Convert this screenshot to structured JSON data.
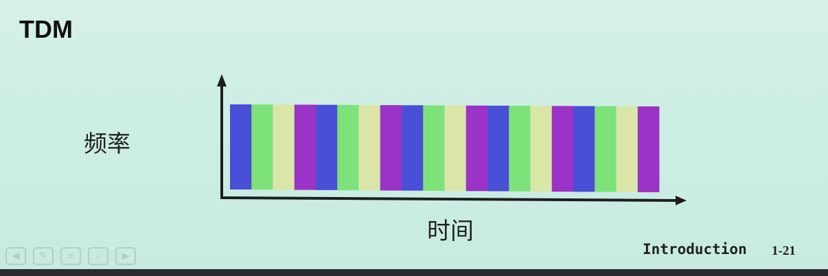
{
  "slide": {
    "title": "TDM",
    "y_axis_label": "频率",
    "x_axis_label": "时间",
    "footer_title": "Introduction",
    "page_number": "1-21"
  },
  "diagram": {
    "slot_colors": {
      "blue": "#4a4fd8",
      "green": "#7ee27a",
      "yellow": "#d9e6a8",
      "purple": "#9a33c6"
    },
    "slots": [
      "blue",
      "green",
      "yellow",
      "purple",
      "blue",
      "green",
      "yellow",
      "purple",
      "blue",
      "green",
      "yellow",
      "purple",
      "blue",
      "green",
      "yellow",
      "purple",
      "blue",
      "green",
      "yellow",
      "purple"
    ],
    "axis_color": "#1e1e1e"
  },
  "controls": {
    "icons": [
      "prev-icon",
      "edit-icon",
      "menu-icon",
      "search-icon",
      "next-icon"
    ]
  }
}
